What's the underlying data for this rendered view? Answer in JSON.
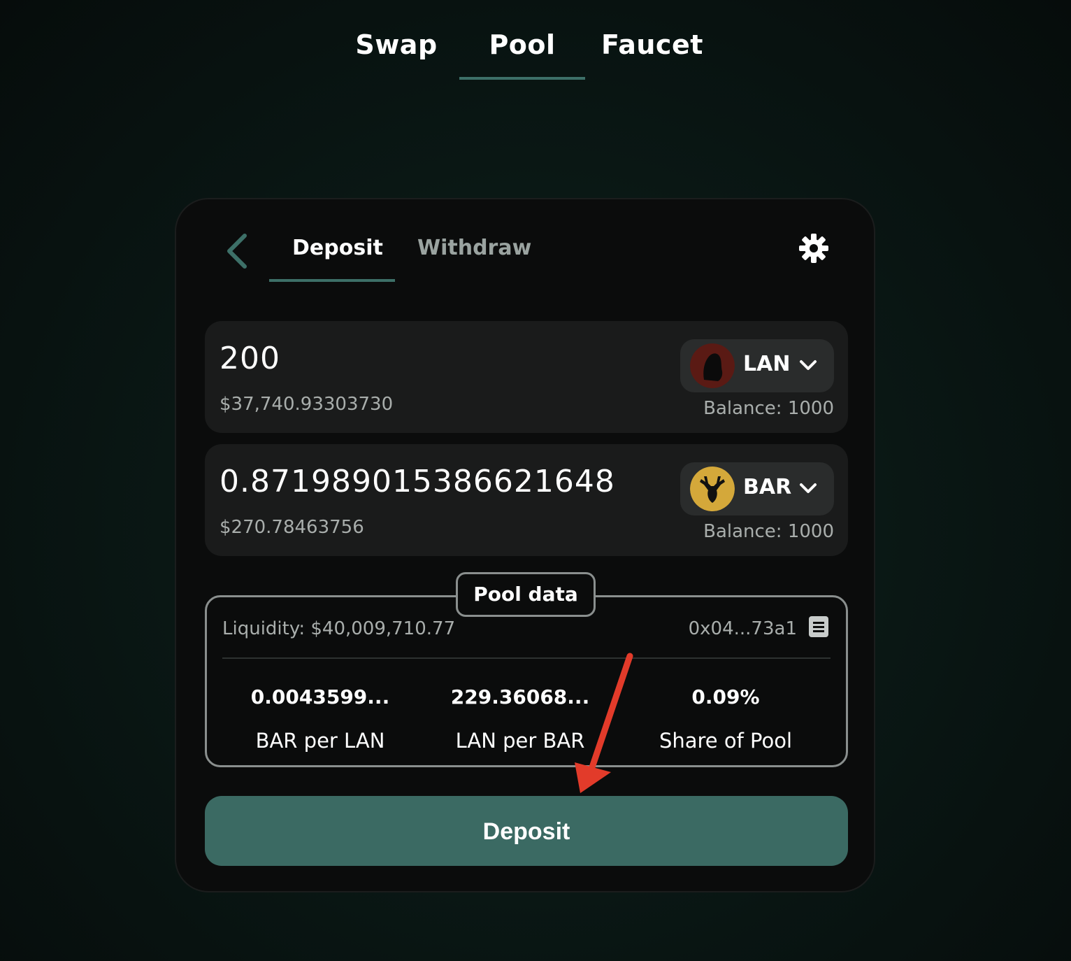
{
  "nav": {
    "tabs": [
      {
        "label": "Swap"
      },
      {
        "label": "Pool"
      },
      {
        "label": "Faucet"
      }
    ],
    "active": "Pool"
  },
  "card": {
    "tabs": {
      "deposit": "Deposit",
      "withdraw": "Withdraw"
    },
    "active_tab": "Deposit",
    "tokens": [
      {
        "amount": "200",
        "usd": "$37,740.93303730",
        "symbol": "LAN",
        "balance": "Balance: 1000"
      },
      {
        "amount": "0.87198901538662164 8",
        "usd": "$270.78463756",
        "symbol": "BAR",
        "balance": "Balance: 1000"
      }
    ],
    "pool": {
      "label": "Pool data",
      "liquidity": "Liquidity: $40,009,710.77",
      "address": "0x04...73a1",
      "stats": [
        {
          "value": "0.0043599...",
          "label": "BAR per LAN"
        },
        {
          "value": "229.36068...",
          "label": "LAN per BAR"
        },
        {
          "value": "0.09%",
          "label": "Share of Pool"
        }
      ]
    },
    "deposit_button": "Deposit"
  },
  "colors": {
    "accent": "#3d7068",
    "button": "#3b6a63",
    "annotation_arrow": "#e23b2a"
  }
}
